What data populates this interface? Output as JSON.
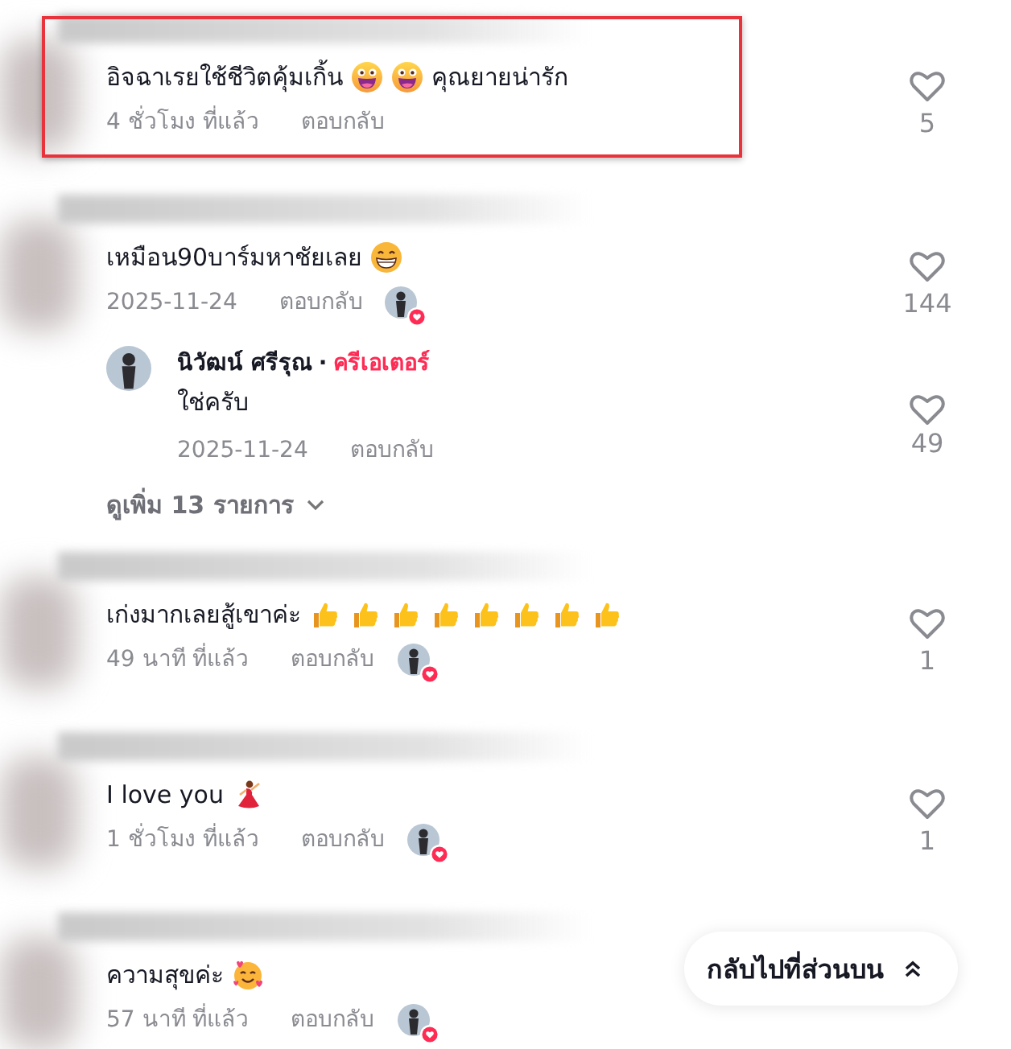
{
  "comments": [
    {
      "highlighted": true,
      "body": [
        {
          "kind": "text",
          "text": "อิจฉาเรยใช้ชีวิตคุ้มเกิ้น"
        },
        {
          "kind": "laughing-face"
        },
        {
          "kind": "laughing-face"
        },
        {
          "kind": "text",
          "text": "คุณยายน่ารัก"
        }
      ],
      "time": "4 ชั่วโมง ที่แล้ว",
      "reply": "ตอบกลับ",
      "creator_liked": false,
      "likes": "5"
    },
    {
      "highlighted": false,
      "body": [
        {
          "kind": "text",
          "text": "เหมือน90บาร์มหาชัยเลย"
        },
        {
          "kind": "grinning-face"
        }
      ],
      "time": "2025-11-24",
      "reply": "ตอบกลับ",
      "creator_liked": true,
      "likes": "144",
      "replies": [
        {
          "author": "นิวัฒน์ ศรีรุณ",
          "separator": "·",
          "badge": "ครีเอเตอร์",
          "text": "ใช่ครับ",
          "time": "2025-11-24",
          "reply": "ตอบกลับ",
          "likes": "49"
        }
      ],
      "more": "ดูเพิ่ม 13 รายการ"
    },
    {
      "highlighted": false,
      "body": [
        {
          "kind": "text",
          "text": "เก่งมากเลยสู้เขาค่ะ"
        },
        {
          "kind": "thumbs-up"
        },
        {
          "kind": "thumbs-up"
        },
        {
          "kind": "thumbs-up"
        },
        {
          "kind": "thumbs-up"
        },
        {
          "kind": "thumbs-up"
        },
        {
          "kind": "thumbs-up"
        },
        {
          "kind": "thumbs-up"
        },
        {
          "kind": "thumbs-up"
        }
      ],
      "time": "49 นาที ที่แล้ว",
      "reply": "ตอบกลับ",
      "creator_liked": true,
      "likes": "1"
    },
    {
      "highlighted": false,
      "body": [
        {
          "kind": "text",
          "text": "I love you"
        },
        {
          "kind": "dancer"
        }
      ],
      "time": "1 ชั่วโมง ที่แล้ว",
      "reply": "ตอบกลับ",
      "creator_liked": true,
      "likes": "1"
    },
    {
      "highlighted": false,
      "body": [
        {
          "kind": "text",
          "text": "ความสุขค่ะ"
        },
        {
          "kind": "smiling-hearts"
        }
      ],
      "time": "57 นาที ที่แล้ว",
      "reply": "ตอบกลับ",
      "creator_liked": true
    }
  ],
  "back_to_top": {
    "label": "กลับไปที่ส่วนบน"
  }
}
